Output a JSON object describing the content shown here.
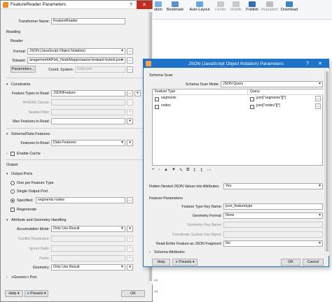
{
  "toolbar": {
    "items": [
      "ation",
      "Bookmark",
      "Auto-Layout",
      "Center",
      "Middle",
      "Publish",
      "Republish",
      "Download"
    ]
  },
  "bg": {
    "ruler_marks": [
      "4Q",
      "4Q"
    ]
  },
  "fr": {
    "title": "FeatureReader Parameters",
    "transformer_name_label": "Transformer Name:",
    "transformer_name_value": "FeatureReader",
    "reading": "Reading",
    "reader": "Reader",
    "format_label": "Format:",
    "format_value": "JSON (JavaScript Object Notation)",
    "dataset_label": "Dataset:",
    "dataset_value": "anagement\\APIvb_NodeMapp\\vlaams-brabant-hybrid.json",
    "params_btn": "Parameters...",
    "coord_label": "Coord. System:",
    "coord_value": "Unknown",
    "constraints": "Constraints",
    "feature_types_label": "Feature Types to Read:",
    "feature_types_value": "JSONFeature",
    "where_label": "WHERE Clause:",
    "spatial_label": "Spatial Filter:",
    "max_features_label": "Max Features to Read:",
    "schema_section": "Schema/Data Features",
    "features_read_label": "Features to Read:",
    "features_read_value": "Data Features",
    "enable_cache": "Enable Cache",
    "output": "Output",
    "output_ports": "Output Ports",
    "one_per_type": "One per Feature Type",
    "single_port": "Single Output Port",
    "specified": "Specified:",
    "specified_value": "segments nodes",
    "regenerate": "Regenerate",
    "attr_handling": "Attribute and Geometry Handling",
    "accum_label": "Accumulation Mode:",
    "accum_value": "Only Use Result",
    "conflict_label": "Conflict Resolution:",
    "ignore_label": "Ignore Nulls:",
    "prefix_label": "Prefix:",
    "geometry_label": "Geometry:",
    "geometry_value": "Only Use Result",
    "generic_port": "<Generic> Port",
    "help": "Help",
    "presets": "Presets",
    "ok": "OK"
  },
  "jp": {
    "title": "JSON (JavaScript Object Notation) Parameters",
    "schema_scan": "Schema Scan",
    "schema_mode_label": "Schema Scan Mode:",
    "schema_mode_value": "JSON Query",
    "col_feature_type": "Feature Type",
    "col_query": "Query",
    "rows": [
      {
        "feature_type": "segments",
        "query": "json[\"segments\"][*]"
      },
      {
        "feature_type": "nodes",
        "query": "json[\"nodes\"][*]"
      }
    ],
    "grid_tools": [
      "+",
      "−",
      "▲",
      "▼",
      "✎",
      "⧉",
      "↧",
      "↥",
      "⋯"
    ],
    "flatten_label": "Flatten Nested JSON Values into Attributes:",
    "flatten_value": "Yes",
    "feature_params": "Feature Parameters",
    "ftype_key_label": "Feature Type Key Name:",
    "ftype_key_value": "json_featuretype",
    "geom_format_label": "Geometry Format:",
    "geom_format_value": "None",
    "geom_key_label": "Geometry Key Name:",
    "coord_key_label": "Coordinate System Key Name:",
    "read_entire_label": "Read Entire Feature as JSON Fragment:",
    "read_entire_value": "No",
    "schema_attrs": "Schema Attributes",
    "help": "Help",
    "presets": "Presets",
    "ok": "OK",
    "cancel": "Cancel"
  },
  "colors": {
    "accent": "#1e73c9",
    "close": "#c42b1c"
  }
}
